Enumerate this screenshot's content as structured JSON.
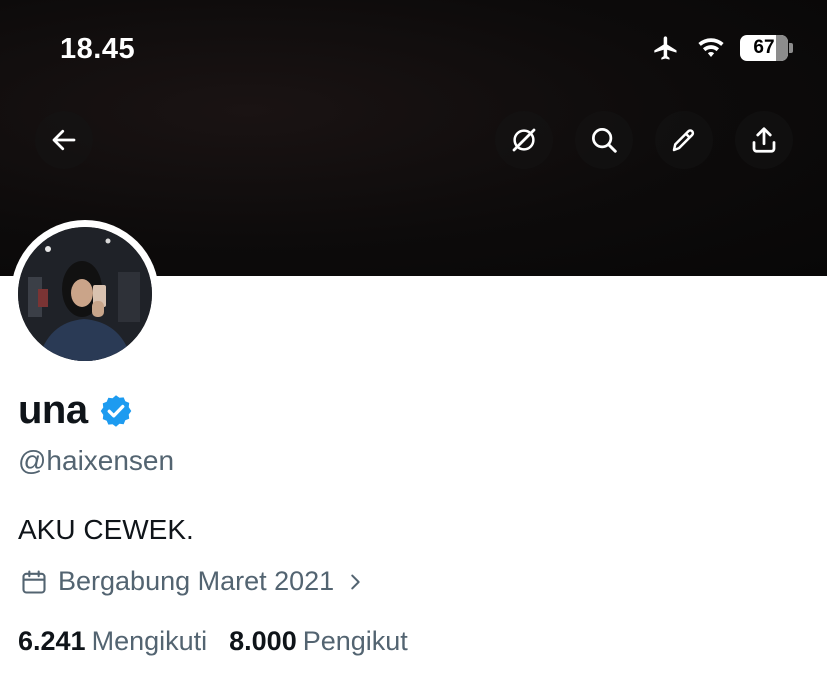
{
  "status_bar": {
    "time": "18.45",
    "battery": "67"
  },
  "header_icons": [
    "back-arrow-icon",
    "grok-icon",
    "search-icon",
    "edit-icon",
    "share-icon"
  ],
  "profile": {
    "name": "una",
    "verified": true,
    "handle": "@haixensen",
    "bio": "AKU CEWEK.",
    "joined": "Bergabung Maret 2021",
    "following_count": "6.241",
    "following_label": "Mengikuti",
    "followers_count": "8.000",
    "followers_label": "Pengikut"
  },
  "colors": {
    "verified_blue": "#1d9bf0",
    "secondary_text": "#536471",
    "primary_text": "#0f1419"
  }
}
